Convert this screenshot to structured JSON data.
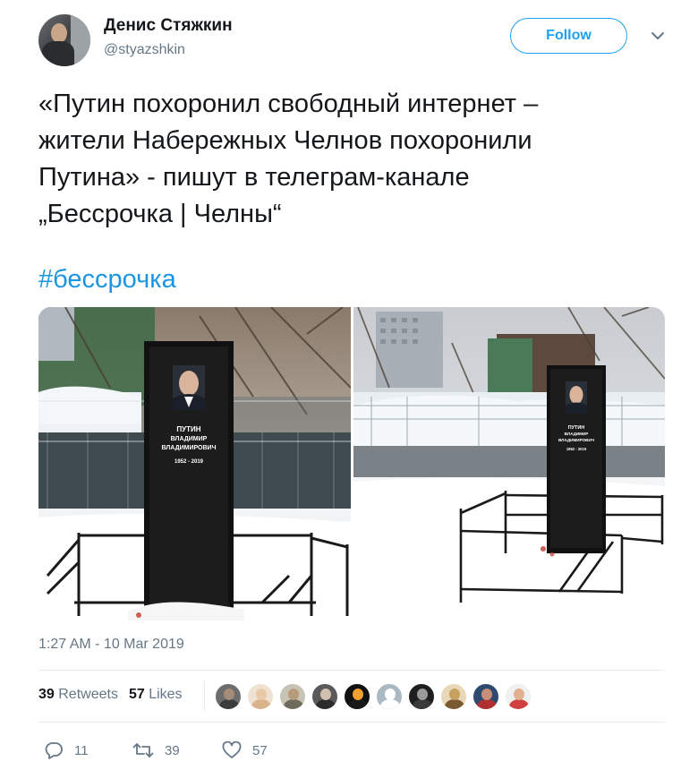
{
  "author": {
    "name": "Денис Стяжкин",
    "handle": "@styazshkin",
    "follow_label": "Follow"
  },
  "tweet": {
    "text_lines": [
      "«Путин похоронил свободный интернет –",
      "жители Набережных Челнов похоронили",
      "Путина» - пишут в телеграм-канале",
      "„Бессрочка | Челны“"
    ],
    "hashtag": "#бессрочка",
    "timestamp": "1:27 AM - 10 Mar 2019"
  },
  "media": {
    "photo_1": {
      "name_line_1": "ПУТИН",
      "name_line_2": "ВЛАДИМИР",
      "name_line_3": "ВЛАДИМИРОВИЧ",
      "years": "1952 - 2019"
    },
    "photo_2": {
      "name_line_1": "ПУТИН",
      "name_line_2": "ВЛАДИМИР",
      "name_line_3": "ВЛАДИМИРОВИЧ",
      "years": "1952 - 2019"
    }
  },
  "stats": {
    "retweets_count": "39",
    "retweets_label": "Retweets",
    "likes_count": "57",
    "likes_label": "Likes"
  },
  "likers": [
    {
      "name": "liker-avatar",
      "head": "#a48b7a",
      "body": "#3b3b3b",
      "bg": "#6d6d6d"
    },
    {
      "name": "liker-avatar",
      "head": "#e7c9a8",
      "body": "#d9b38c",
      "bg": "#f0e2d2"
    },
    {
      "name": "liker-avatar",
      "head": "#b89a7c",
      "body": "#6e6a5c",
      "bg": "#c7c3b5"
    },
    {
      "name": "liker-avatar",
      "head": "#d0c0b0",
      "body": "#2c2c2c",
      "bg": "#5a5a5a"
    },
    {
      "name": "liker-avatar",
      "head": "#f2a030",
      "body": "#1a1a1a",
      "bg": "#111111"
    },
    {
      "name": "liker-avatar",
      "head": "#ffffff",
      "body": "#ffffff",
      "bg": "#aab8c2"
    },
    {
      "name": "liker-avatar",
      "head": "#9a9a9a",
      "body": "#3a3a3a",
      "bg": "#1e1e1e"
    },
    {
      "name": "liker-avatar",
      "head": "#c8a060",
      "body": "#7a5a30",
      "bg": "#e8d8b8"
    },
    {
      "name": "liker-avatar",
      "head": "#c98f7a",
      "body": "#b03030",
      "bg": "#2e4a6e"
    },
    {
      "name": "liker-avatar",
      "head": "#e0b090",
      "body": "#d04040",
      "bg": "#f0f0f0"
    }
  ],
  "actions": {
    "replies": "11",
    "retweets": "39",
    "likes": "57"
  },
  "colors": {
    "accent": "#1da1f2",
    "hashtag": "#1b95e0",
    "muted": "#657786"
  }
}
